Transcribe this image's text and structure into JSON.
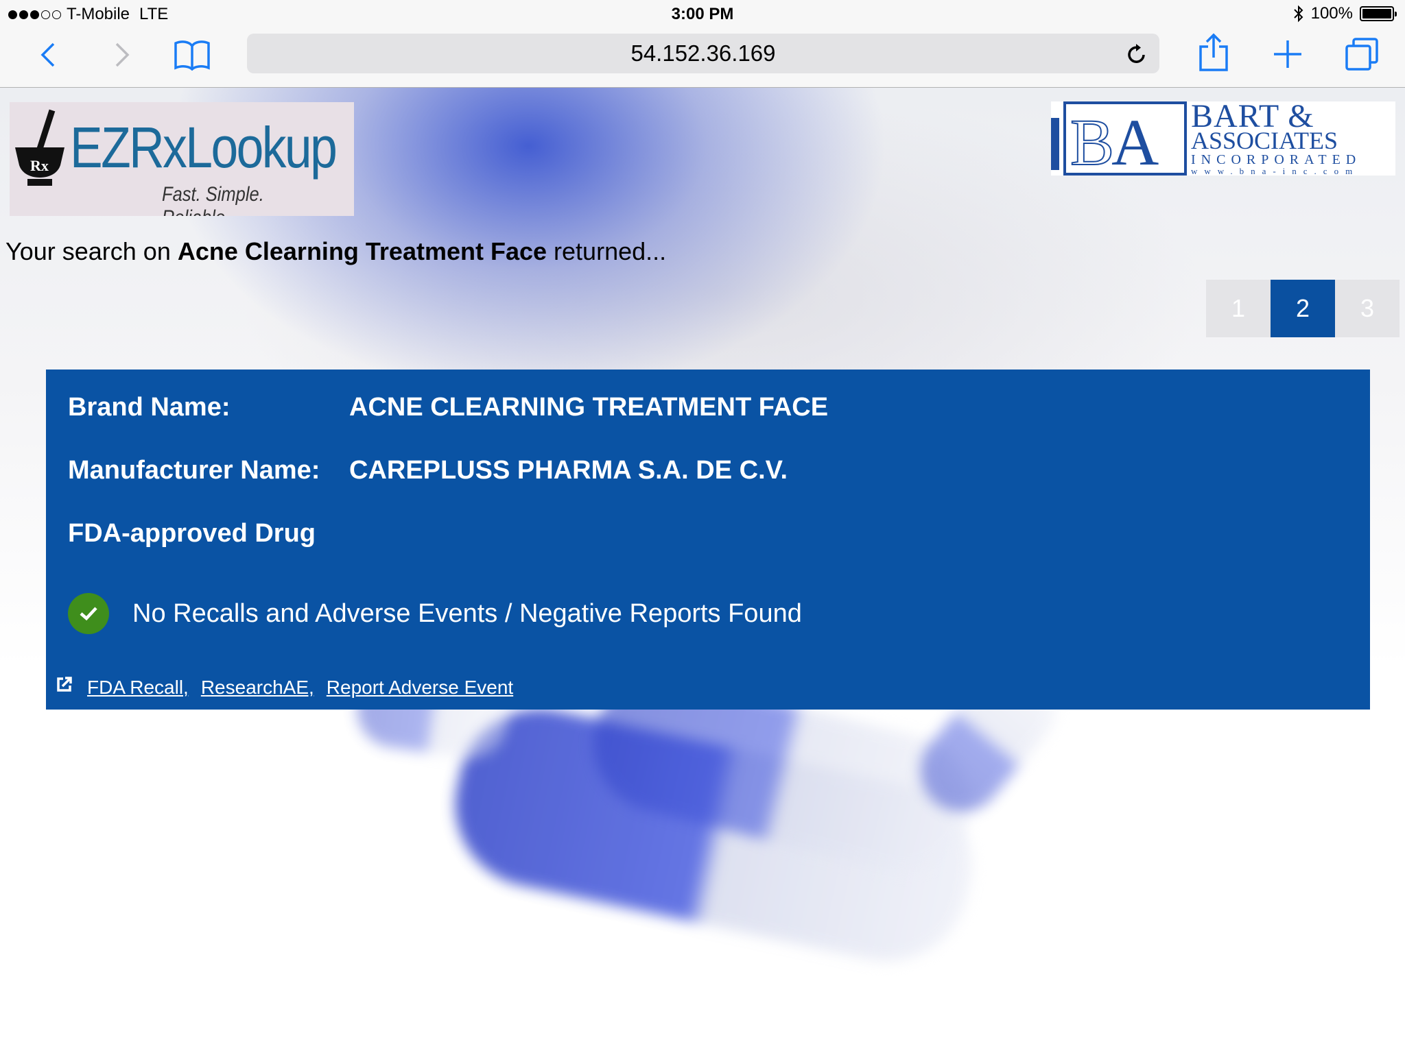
{
  "status_bar": {
    "carrier": "T-Mobile",
    "network": "LTE",
    "time": "3:00 PM",
    "battery": "100%",
    "battery_level": 1.0
  },
  "browser": {
    "url": "54.152.36.169"
  },
  "logos": {
    "ez_name": "EZRxLookup",
    "ez_tagline": "Fast. Simple. Reliable.",
    "bart_name": "BART &",
    "bart_sub": "ASSOCIATES",
    "bart_inc": "INCORPORATED",
    "bart_web": "www.bna-inc.com"
  },
  "search": {
    "prefix": "Your search on",
    "term": "Acne Clearning Treatment Face",
    "suffix": "returned..."
  },
  "pagination": {
    "pages": [
      "1",
      "2",
      "3"
    ],
    "current": "2"
  },
  "result": {
    "brand_label": "Brand Name:",
    "brand_value": "ACNE CLEARNING TREATMENT FACE",
    "manufacturer_label": "Manufacturer Name:",
    "manufacturer_value": "CAREPLUSS PHARMA S.A. DE C.V.",
    "approval": "FDA-approved Drug",
    "status": "No Recalls and Adverse Events / Negative Reports Found",
    "links": [
      "FDA Recall,",
      "ResearchAE,",
      "Report Adverse Event"
    ]
  },
  "colors": {
    "card": "#0a53a4",
    "active_page": "#0a50a0",
    "check": "#3f8e1c",
    "ios_blue": "#1a7cf5"
  }
}
